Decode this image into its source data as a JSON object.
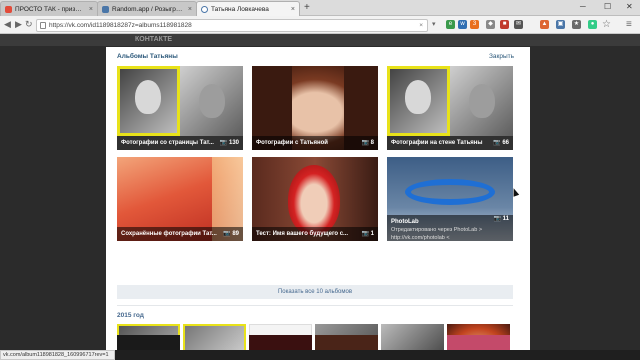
{
  "browser": {
    "tabs": [
      {
        "title": "ПРОСТО ТАК - призы и ...",
        "color": "#e24b3a"
      },
      {
        "title": "Random.app / Розыгрыш...",
        "color": "#4a76a8"
      },
      {
        "title": "Татьяна Ловкачева",
        "color": "#4a76a8"
      }
    ],
    "url": "https://vk.com/id1189818287z=albums118981828",
    "url_prefix": "https://vk.com/",
    "ext_badge": "3"
  },
  "vk": {
    "logo": "КОНТАКТЕ"
  },
  "modal": {
    "title": "Альбомы Татьяны",
    "close_label": "Закрыть",
    "albums": [
      {
        "title": "Фотографии со страницы Тат...",
        "count": "130"
      },
      {
        "title": "Фотографии с Татьяной",
        "count": "8"
      },
      {
        "title": "Фотографии на стене Татьяны",
        "count": "66"
      },
      {
        "title": "Сохранённые фотографии Тат...",
        "count": "89"
      },
      {
        "title": "Тест: Имя вашего будущего с...",
        "count": "1"
      },
      {
        "title": "PhotoLab",
        "count": "11",
        "subtitle": "Отредактировано через PhotoLab > http://vk.com/photolab <"
      }
    ],
    "show_all_label": "Показать все 10 альбомов",
    "year_label": "2015 год"
  },
  "status_url": "vk.com/album118981828_160996717rev=1"
}
